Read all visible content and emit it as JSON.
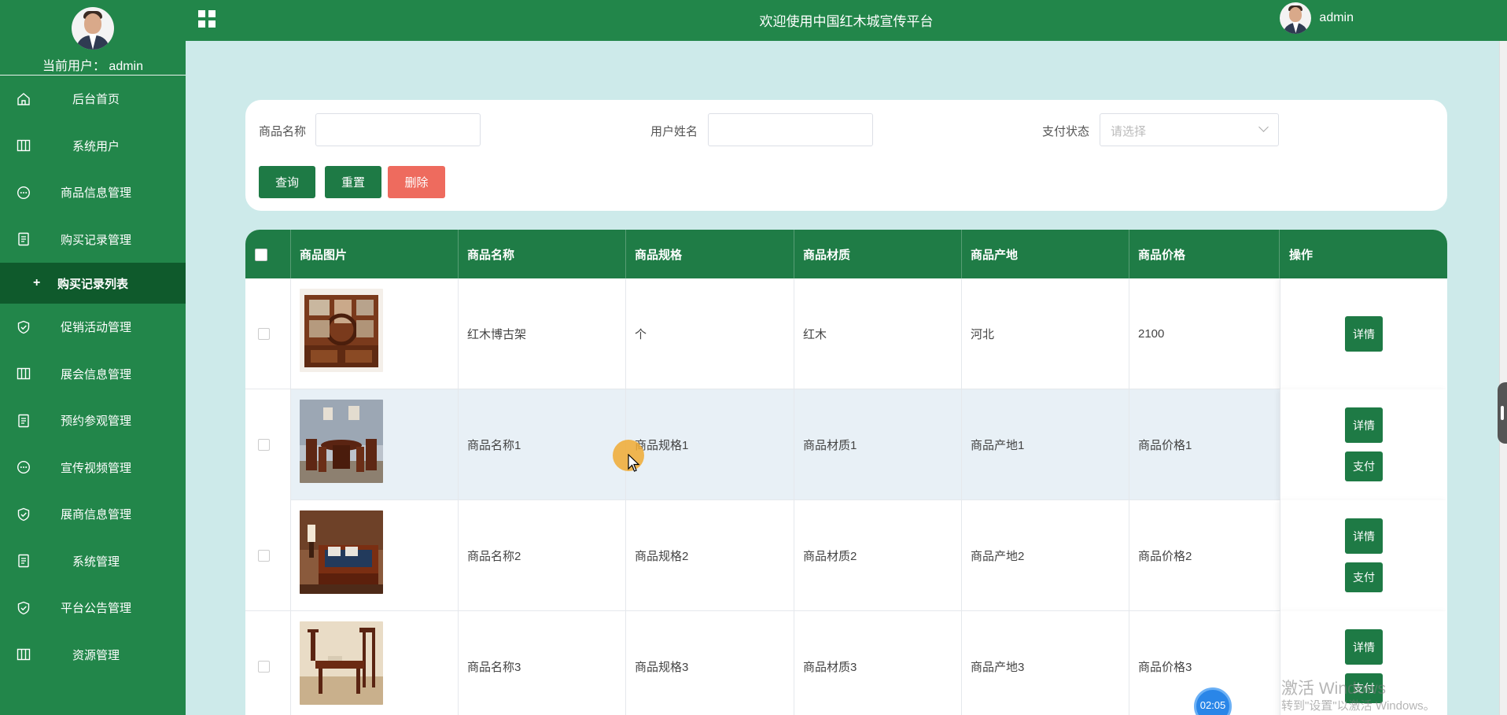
{
  "sidebar": {
    "current_user": "当前用户： admin",
    "items": [
      {
        "label": "后台首页",
        "icon": "home-icon"
      },
      {
        "label": "系统用户",
        "icon": "columns-icon"
      },
      {
        "label": "商品信息管理",
        "icon": "chat-icon"
      },
      {
        "label": "购买记录管理",
        "icon": "document-icon"
      },
      {
        "label": "购买记录列表",
        "icon": "plus-icon",
        "active": true
      },
      {
        "label": "促销活动管理",
        "icon": "shield-check-icon"
      },
      {
        "label": "展会信息管理",
        "icon": "columns-icon"
      },
      {
        "label": "预约参观管理",
        "icon": "document-icon"
      },
      {
        "label": "宣传视频管理",
        "icon": "chat-icon"
      },
      {
        "label": "展商信息管理",
        "icon": "shield-check-icon"
      },
      {
        "label": "系统管理",
        "icon": "document-icon"
      },
      {
        "label": "平台公告管理",
        "icon": "shield-check-icon"
      },
      {
        "label": "资源管理",
        "icon": "columns-icon"
      }
    ]
  },
  "header": {
    "title": "欢迎使用中国红木城宣传平台",
    "username": "admin"
  },
  "search": {
    "product_name_label": "商品名称",
    "user_name_label": "用户姓名",
    "pay_status_label": "支付状态",
    "pay_status_placeholder": "请选择",
    "query_label": "查询",
    "reset_label": "重置",
    "delete_label": "删除"
  },
  "table": {
    "headers": [
      "商品图片",
      "商品名称",
      "商品规格",
      "商品材质",
      "商品产地",
      "商品价格",
      "操作"
    ],
    "detail_label": "详情",
    "pay_label": "支付",
    "rows": [
      {
        "name": "红木博古架",
        "spec": "个",
        "material": "红木",
        "origin": "河北",
        "price": "2100"
      },
      {
        "name": "商品名称1",
        "spec": "商品规格1",
        "material": "商品材质1",
        "origin": "商品产地1",
        "price": "商品价格1"
      },
      {
        "name": "商品名称2",
        "spec": "商品规格2",
        "material": "商品材质2",
        "origin": "商品产地2",
        "price": "商品价格2"
      },
      {
        "name": "商品名称3",
        "spec": "商品规格3",
        "material": "商品材质3",
        "origin": "商品产地3",
        "price": "商品价格3"
      }
    ]
  },
  "overlay": {
    "timer": "02:05",
    "watermark_line1": "激活 Windows",
    "watermark_line2": "转到\"设置\"以激活 Windows。"
  },
  "colors": {
    "primary_green": "#22864a",
    "header_green": "#1f7c46",
    "delete_red": "#ee6b5e",
    "content_bg": "#cdeaea"
  }
}
